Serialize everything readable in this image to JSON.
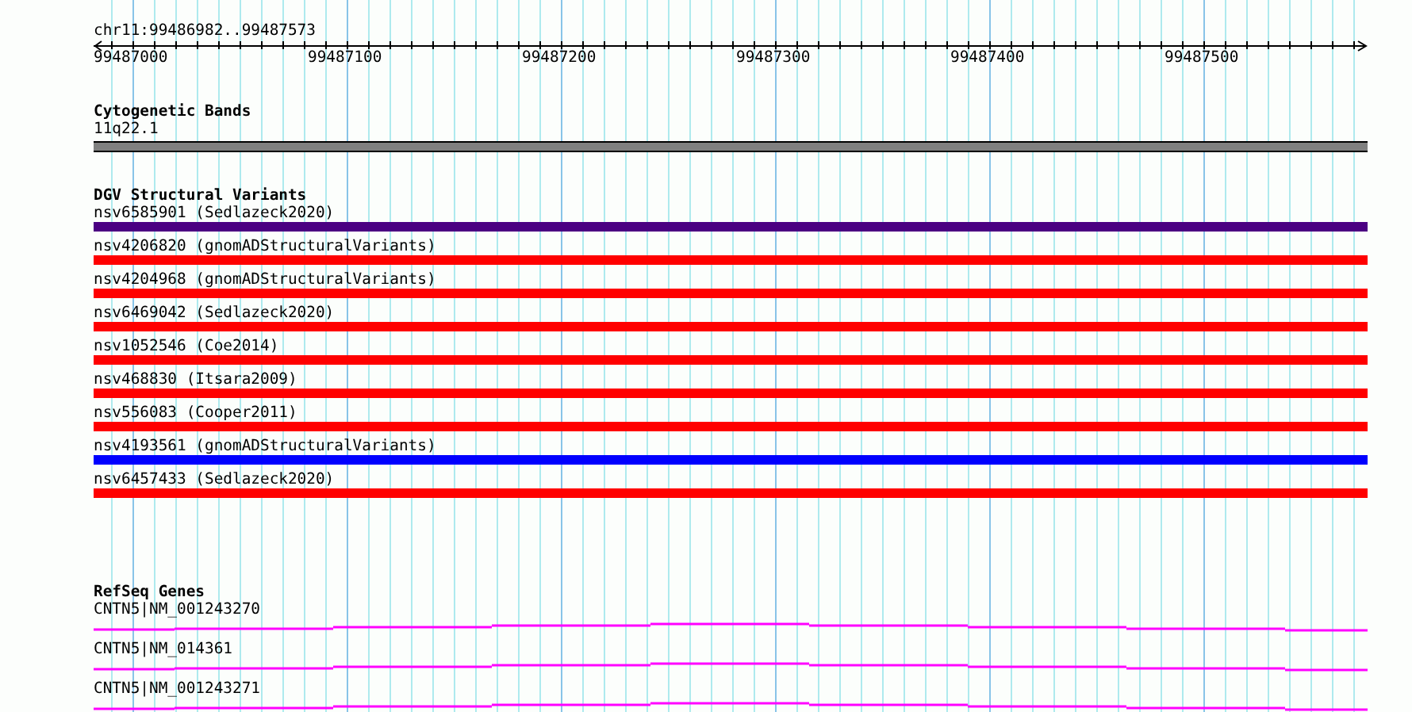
{
  "ruler": {
    "location": "chr11:99486982..99487573",
    "ticks": [
      "99487000",
      "99487100",
      "99487200",
      "99487300",
      "99487400",
      "99487500"
    ]
  },
  "tracks": [
    {
      "kind": "band",
      "title": "Cytogenetic Bands",
      "features": [
        {
          "label": "11q22.1"
        }
      ]
    },
    {
      "kind": "variant",
      "title": "DGV Structural Variants",
      "features": [
        {
          "label": "nsv6585901 (Sedlazeck2020)",
          "color": "#4b0082"
        },
        {
          "label": "nsv4206820 (gnomADStructuralVariants)",
          "color": "#ff0000"
        },
        {
          "label": "nsv4204968 (gnomADStructuralVariants)",
          "color": "#ff0000"
        },
        {
          "label": "nsv6469042 (Sedlazeck2020)",
          "color": "#ff0000"
        },
        {
          "label": "nsv1052546 (Coe2014)",
          "color": "#ff0000"
        },
        {
          "label": "nsv468830 (Itsara2009)",
          "color": "#ff0000"
        },
        {
          "label": "nsv556083 (Cooper2011)",
          "color": "#ff0000"
        },
        {
          "label": "nsv4193561 (gnomADStructuralVariants)",
          "color": "#0000ff"
        },
        {
          "label": "nsv6457433 (Sedlazeck2020)",
          "color": "#ff0000"
        }
      ]
    },
    {
      "kind": "gene",
      "title": "RefSeq Genes",
      "features": [
        {
          "label": "CNTN5|NM_001243270"
        },
        {
          "label": "CNTN5|NM_014361"
        },
        {
          "label": "CNTN5|NM_001243271"
        }
      ]
    }
  ]
}
